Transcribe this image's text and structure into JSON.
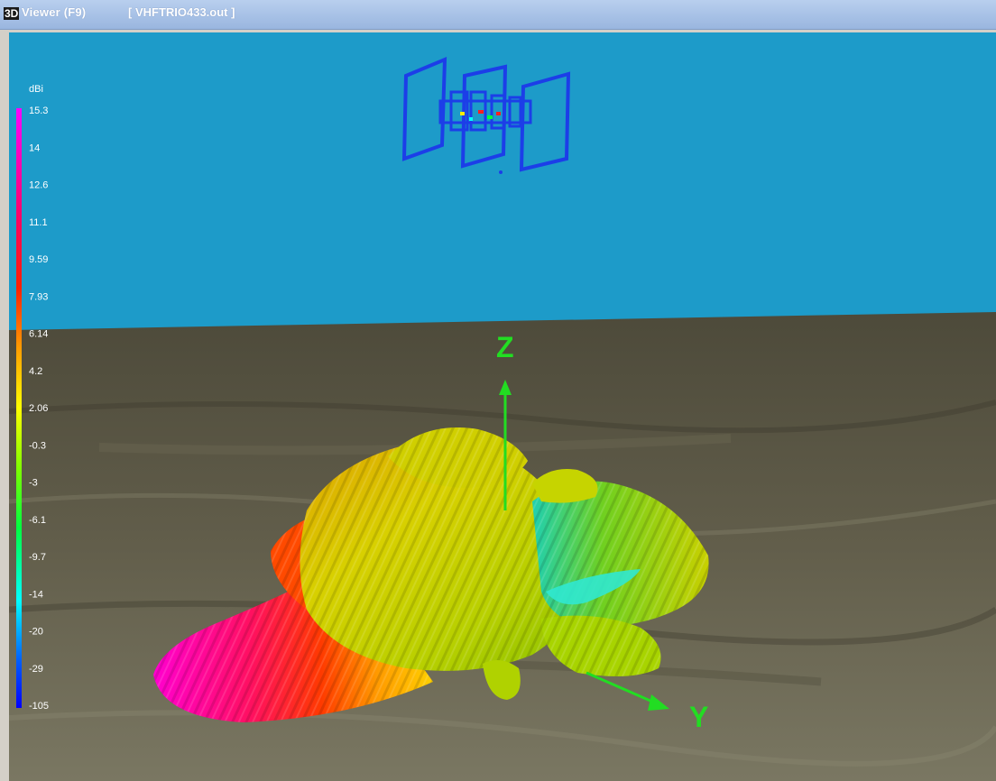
{
  "window": {
    "app_title": "Viewer (F9)",
    "file_title": "[  VHFTRIO433.out ]",
    "logo_text": "3D",
    "logo_icon": "3d-logo-icon"
  },
  "scale": {
    "unit": "dBi",
    "ticks": [
      "15.3",
      "14",
      "12.6",
      "11.1",
      "9.59",
      "7.93",
      "6.14",
      "4.2",
      "2.06",
      "-0.3",
      "-3",
      "-6.1",
      "-9.7",
      "-14",
      "-20",
      "-29",
      "-105"
    ],
    "gradient_colors": [
      "#ff00ff",
      "#ff0060",
      "#ff2a00",
      "#ff9a00",
      "#ffff00",
      "#7fff00",
      "#00ff40",
      "#00ffff",
      "#0060ff",
      "#0000ff"
    ]
  },
  "axes": {
    "z_label": "Z",
    "y_label": "Y",
    "axis_color": "#22dd22"
  },
  "scene": {
    "sky_color": "#1d9bc9",
    "ground_color": "#5f5b47",
    "antenna_color": "#1c3ee8"
  }
}
